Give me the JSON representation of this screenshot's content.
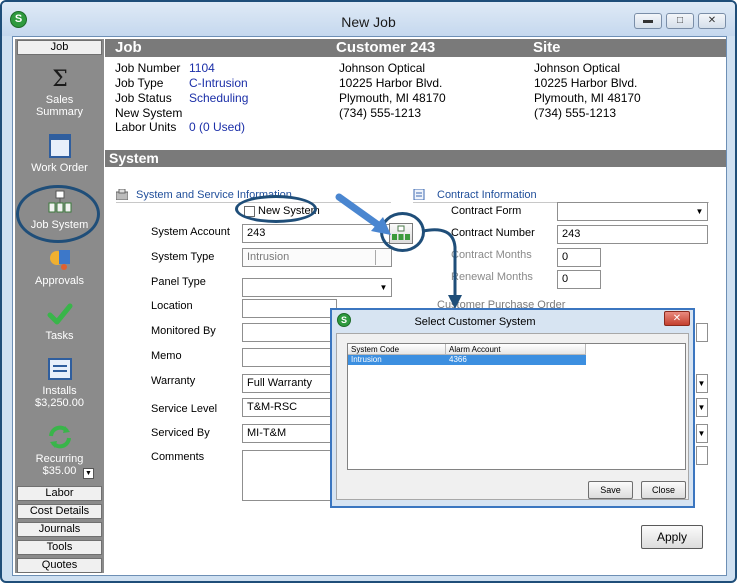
{
  "window": {
    "title": "New Job"
  },
  "nav": {
    "top_tab": "Job",
    "items": [
      {
        "label": "Sales\nSummary",
        "icon": "sigma-icon"
      },
      {
        "label": "Work Order",
        "icon": "work-order-icon"
      },
      {
        "label": "Job System",
        "icon": "job-system-icon"
      },
      {
        "label": "Approvals",
        "icon": "approvals-icon"
      },
      {
        "label": "Tasks",
        "icon": "checkmark-icon"
      },
      {
        "label": "Installs\n$3,250.00",
        "icon": "installs-icon"
      },
      {
        "label": "Recurring\n$35.00",
        "icon": "recurring-icon"
      }
    ],
    "bottom_tabs": [
      "Labor",
      "Cost Details",
      "Journals",
      "Tools",
      "Quotes"
    ]
  },
  "header": {
    "job_title": "Job",
    "customer_title": "Customer 243",
    "site_title": "Site",
    "job_fields": [
      {
        "label": "Job Number",
        "value": "1104"
      },
      {
        "label": "Job Type",
        "value": "C-Intrusion"
      },
      {
        "label": "Job Status",
        "value": "Scheduling"
      },
      {
        "label": "New System",
        "value": ""
      },
      {
        "label": "Labor Units",
        "value": "0 (0 Used)"
      }
    ],
    "customer_lines": [
      "Johnson Optical",
      "10225 Harbor Blvd.",
      "Plymouth, MI  48170",
      "(734) 555-1213"
    ],
    "site_lines": [
      "Johnson Optical",
      "10225 Harbor Blvd.",
      "Plymouth, MI  48170",
      "(734) 555-1213"
    ]
  },
  "system": {
    "band_title": "System",
    "section_left": "System and Service Information",
    "section_right": "Contract Information",
    "section_right2": "Customer Purchase Order",
    "new_system_label": "New System",
    "fields": {
      "system_account": {
        "label": "System Account",
        "value": "243"
      },
      "system_type": {
        "label": "System Type",
        "value": "Intrusion"
      },
      "panel_type": {
        "label": "Panel Type",
        "value": ""
      },
      "location": {
        "label": "Location",
        "value": ""
      },
      "monitored_by": {
        "label": "Monitored By",
        "value": ""
      },
      "memo": {
        "label": "Memo",
        "value": ""
      },
      "warranty": {
        "label": "Warranty",
        "value": "Full Warranty"
      },
      "service_level": {
        "label": "Service Level",
        "value": "T&M-RSC"
      },
      "serviced_by": {
        "label": "Serviced By",
        "value": "MI-T&M"
      },
      "comments": {
        "label": "Comments",
        "value": ""
      }
    },
    "contract": {
      "form": {
        "label": "Contract Form",
        "value": ""
      },
      "number": {
        "label": "Contract Number",
        "value": "243"
      },
      "months": {
        "label": "Contract Months",
        "value": "0"
      },
      "renewal": {
        "label": "Renewal Months",
        "value": "0"
      }
    }
  },
  "dialog": {
    "title": "Select Customer System",
    "close_glyph": "✕",
    "columns": [
      "System Code",
      "Alarm Account"
    ],
    "rows": [
      {
        "system_code": "Intrusion",
        "alarm_account": "4366"
      }
    ],
    "save_label": "Save",
    "close_label": "Close"
  },
  "apply_label": "Apply",
  "colors": {
    "accent_blue": "#1f4e79",
    "band_gray": "#7a7a7a",
    "value_blue": "#1b2fa8",
    "selection": "#3c8fe0"
  }
}
